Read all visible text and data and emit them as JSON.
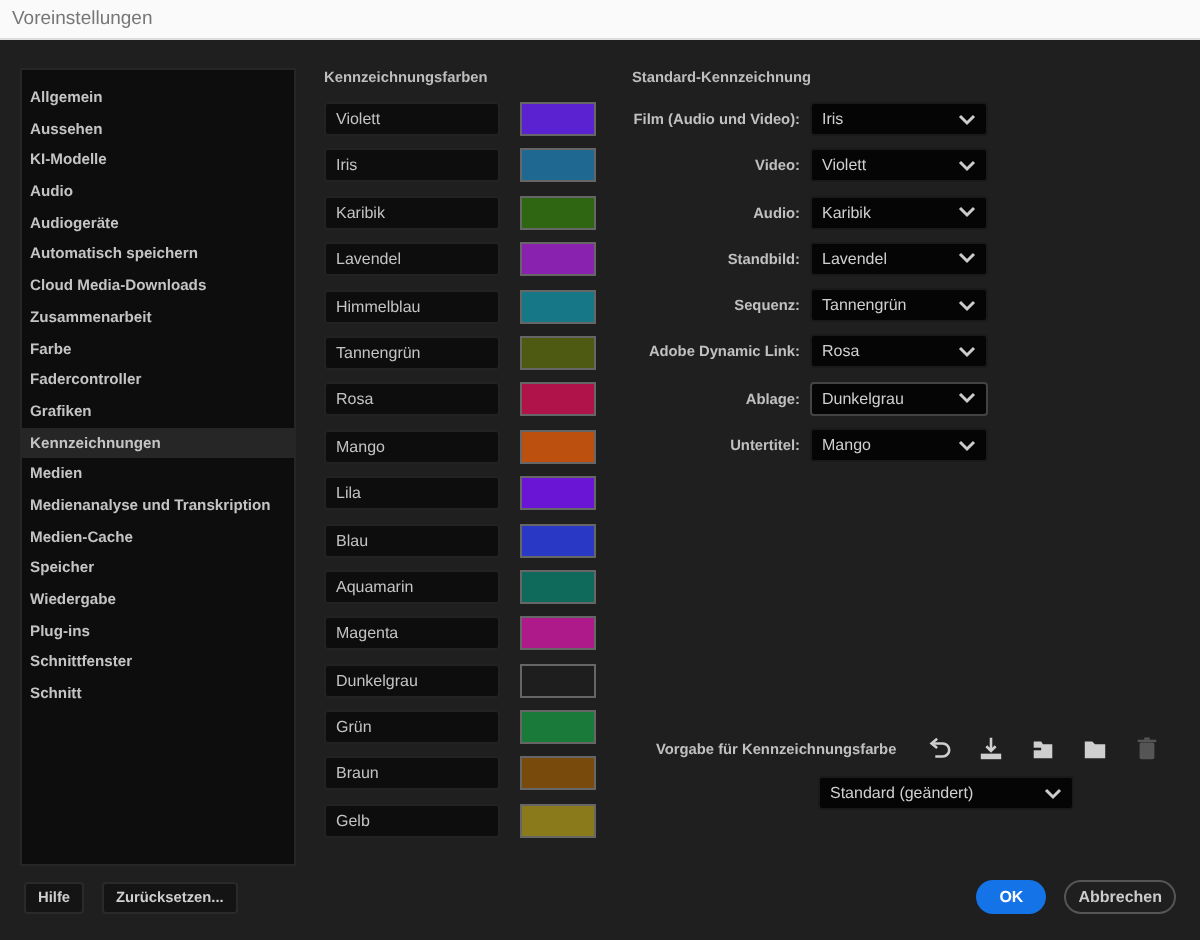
{
  "window": {
    "title": "Voreinstellungen"
  },
  "sidebar": {
    "items": [
      {
        "label": "Allgemein",
        "selected": false
      },
      {
        "label": "Aussehen",
        "selected": false
      },
      {
        "label": "KI-Modelle",
        "selected": false
      },
      {
        "label": "Audio",
        "selected": false
      },
      {
        "label": "Audiogeräte",
        "selected": false
      },
      {
        "label": "Automatisch speichern",
        "selected": false
      },
      {
        "label": "Cloud Media-Downloads",
        "selected": false
      },
      {
        "label": "Zusammenarbeit",
        "selected": false
      },
      {
        "label": "Farbe",
        "selected": false
      },
      {
        "label": "Fadercontroller",
        "selected": false
      },
      {
        "label": "Grafiken",
        "selected": false
      },
      {
        "label": "Kennzeichnungen",
        "selected": true
      },
      {
        "label": "Medien",
        "selected": false
      },
      {
        "label": "Medienanalyse und Transkription",
        "selected": false
      },
      {
        "label": "Medien-Cache",
        "selected": false
      },
      {
        "label": "Speicher",
        "selected": false
      },
      {
        "label": "Wiedergabe",
        "selected": false
      },
      {
        "label": "Plug-ins",
        "selected": false
      },
      {
        "label": "Schnittfenster",
        "selected": false
      },
      {
        "label": "Schnitt",
        "selected": false
      }
    ]
  },
  "label_colors": {
    "title": "Kennzeichnungsfarben",
    "items": [
      {
        "name": "Violett",
        "color": "#5a22d0"
      },
      {
        "name": "Iris",
        "color": "#1f6892"
      },
      {
        "name": "Karibik",
        "color": "#2e6612"
      },
      {
        "name": "Lavendel",
        "color": "#8a22b0"
      },
      {
        "name": "Himmelblau",
        "color": "#167886"
      },
      {
        "name": "Tannengrün",
        "color": "#4e5a12"
      },
      {
        "name": "Rosa",
        "color": "#b0124a"
      },
      {
        "name": "Mango",
        "color": "#bc500e"
      },
      {
        "name": "Lila",
        "color": "#6a14d6"
      },
      {
        "name": "Blau",
        "color": "#2a38c6"
      },
      {
        "name": "Aquamarin",
        "color": "#106a5c"
      },
      {
        "name": "Magenta",
        "color": "#ae1a8a"
      },
      {
        "name": "Dunkelgrau",
        "color": "#1e1e1e"
      },
      {
        "name": "Grün",
        "color": "#1a7a3a"
      },
      {
        "name": "Braun",
        "color": "#784a0c"
      },
      {
        "name": "Gelb",
        "color": "#8a7a1c"
      }
    ]
  },
  "default_labels": {
    "title": "Standard-Kennzeichnung",
    "rows": [
      {
        "label": "Film (Audio und Video):",
        "value": "Iris",
        "hovered": false
      },
      {
        "label": "Video:",
        "value": "Violett",
        "hovered": false
      },
      {
        "label": "Audio:",
        "value": "Karibik",
        "hovered": false
      },
      {
        "label": "Standbild:",
        "value": "Lavendel",
        "hovered": false
      },
      {
        "label": "Sequenz:",
        "value": "Tannengrün",
        "hovered": false
      },
      {
        "label": "Adobe Dynamic Link:",
        "value": "Rosa",
        "hovered": false
      },
      {
        "label": "Ablage:",
        "value": "Dunkelgrau",
        "hovered": true
      },
      {
        "label": "Untertitel:",
        "value": "Mango",
        "hovered": false
      }
    ]
  },
  "preset": {
    "label": "Vorgabe für Kennzeichnungsfarbe",
    "tools": [
      {
        "kind": "undo",
        "disabled": false
      },
      {
        "kind": "download",
        "disabled": false
      },
      {
        "kind": "import",
        "disabled": false
      },
      {
        "kind": "folder",
        "disabled": false
      },
      {
        "kind": "trash",
        "disabled": true
      }
    ],
    "value": "Standard (geändert)"
  },
  "footer": {
    "left_buttons": [
      "Hilfe",
      "Zurücksetzen..."
    ],
    "ok": "OK",
    "cancel": "Abbrechen"
  }
}
